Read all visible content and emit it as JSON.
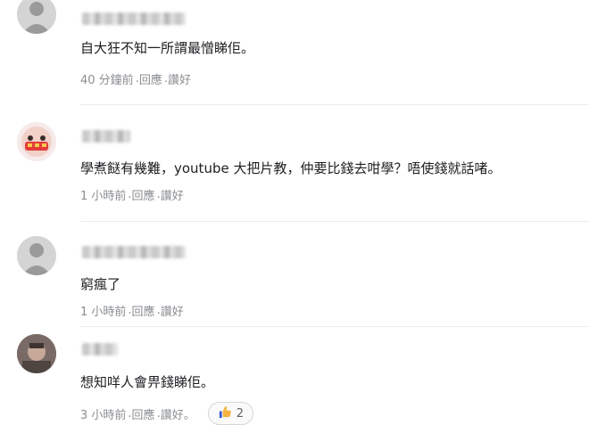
{
  "comments": [
    {
      "text": "自大狂不知一所謂最憎睇佢。",
      "time": "40 分鐘前",
      "reply": "回應",
      "like": "讚好"
    },
    {
      "text": "學煮餸有幾難，youtube 大把片教，仲要比錢去咁學？唔使錢就話啫。",
      "time": "1 小時前",
      "reply": "回應",
      "like": "讚好"
    },
    {
      "text": "窮瘋了",
      "time": "1 小時前",
      "reply": "回應",
      "like": "讚好"
    },
    {
      "text": "想知咩人會畀錢睇佢。",
      "time": "3 小時前",
      "reply": "回應",
      "like": "讚好。",
      "like_count": "2"
    }
  ],
  "sep": "."
}
